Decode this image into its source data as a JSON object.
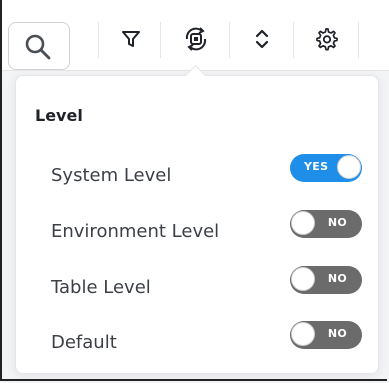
{
  "toolbar": {
    "icons": [
      "search-icon",
      "filter-icon",
      "rotate-view-icon",
      "sort-icon",
      "gear-icon"
    ]
  },
  "popover": {
    "title": "Level",
    "rows": [
      {
        "label": "System Level",
        "toggle_text": "YES",
        "on": true
      },
      {
        "label": "Environment Level",
        "toggle_text": "NO",
        "on": false
      },
      {
        "label": "Table Level",
        "toggle_text": "NO",
        "on": false
      },
      {
        "label": "Default",
        "toggle_text": "NO",
        "on": false
      }
    ]
  },
  "colors": {
    "toggle_on": "#1e8ee8",
    "toggle_off": "#6b6b6b"
  }
}
